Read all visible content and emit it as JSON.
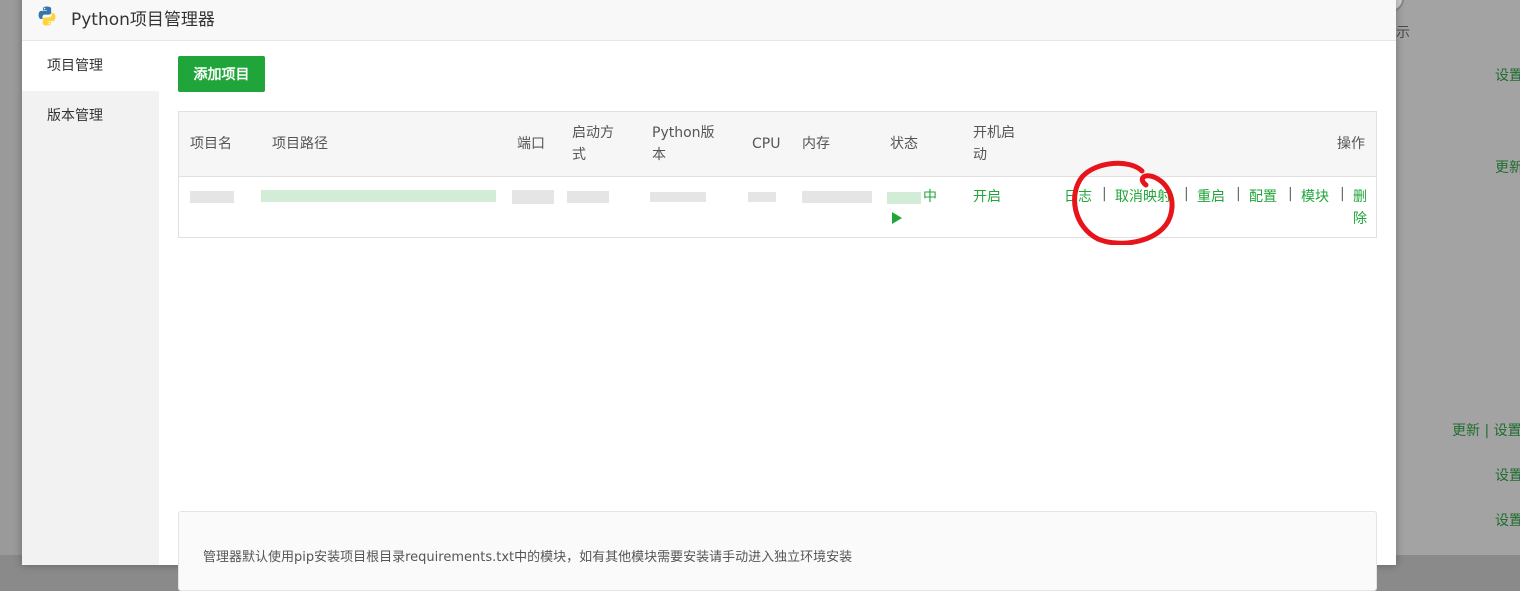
{
  "window": {
    "title": "Python项目管理器"
  },
  "sidebar": {
    "items": [
      {
        "label": "项目管理",
        "active": true
      },
      {
        "label": "版本管理",
        "active": false
      }
    ]
  },
  "toolbar": {
    "add_label": "添加项目"
  },
  "table": {
    "headers": {
      "name": "项目名",
      "path": "项目路径",
      "port": "端口",
      "start_mode_l1": "启动方",
      "start_mode_l2": "式",
      "python_l1": "Python版",
      "python_l2": "本",
      "cpu": "CPU",
      "memory": "内存",
      "status": "状态",
      "autostart_l1": "开机启",
      "autostart_l2": "动",
      "actions": "操作"
    },
    "rows": [
      {
        "status_suffix": "中",
        "autostart": "开启",
        "actions": {
          "log": "日志",
          "unmap": "取消映射",
          "restart": "重启",
          "config": "配置",
          "modules": "模块",
          "delete_l1": "删",
          "delete_l2": "除",
          "separator": "|"
        }
      }
    ]
  },
  "note": {
    "text": "管理器默认使用pip安装项目根目录requirements.txt中的模块，如有其他模块需要安装请手动进入独立环境安装"
  },
  "background": {
    "header_tail": "示",
    "links": [
      "设置",
      "更新",
      "更新 | 设置",
      "设置",
      "设置"
    ]
  },
  "colors": {
    "accent": "#20a53a",
    "annotation": "#e8141b"
  },
  "icons": {
    "app_logo": "python-logo-icon",
    "status": "play-icon"
  }
}
